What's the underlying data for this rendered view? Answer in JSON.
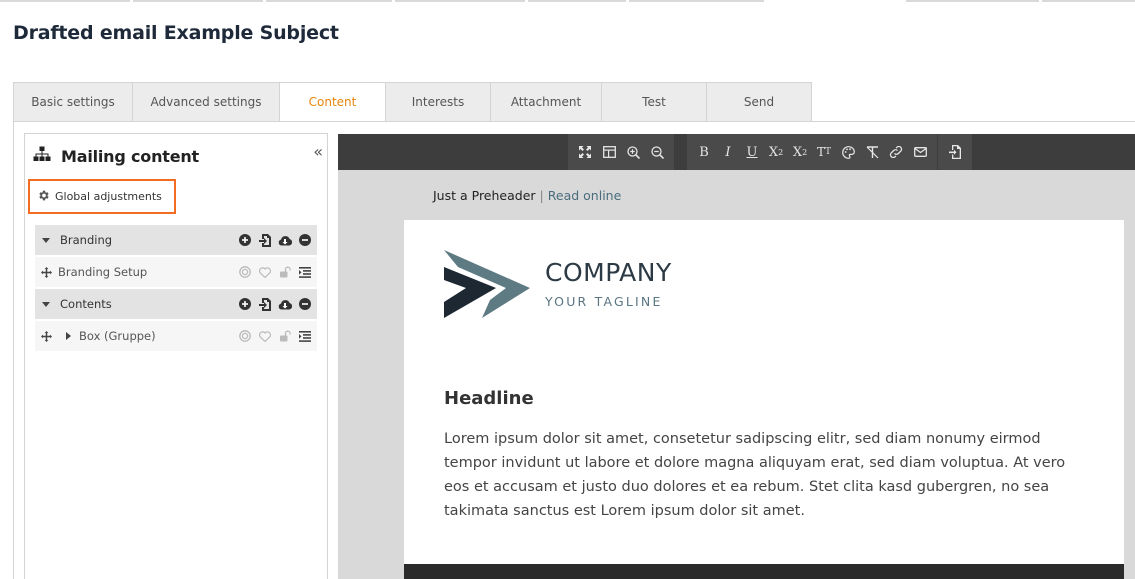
{
  "page": {
    "title": "Drafted email Example Subject"
  },
  "tabs": [
    {
      "label": "Basic settings",
      "active": false
    },
    {
      "label": "Advanced settings",
      "active": false
    },
    {
      "label": "Content",
      "active": true
    },
    {
      "label": "Interests",
      "active": false
    },
    {
      "label": "Attachment",
      "active": false
    },
    {
      "label": "Test",
      "active": false
    },
    {
      "label": "Send",
      "active": false
    }
  ],
  "left_panel": {
    "title": "Mailing content",
    "collapse_icon": "double-chevron-left-icon",
    "global_adjustments": "Global adjustments",
    "tree": [
      {
        "type": "group",
        "label": "Branding"
      },
      {
        "type": "item",
        "label": "Branding Setup"
      },
      {
        "type": "group",
        "label": "Contents"
      },
      {
        "type": "item",
        "label": "Box (Gruppe)"
      }
    ]
  },
  "toolbar": {
    "groups": [
      [
        "maximize-icon",
        "layout-icon",
        "zoom-in-icon",
        "zoom-out-icon"
      ],
      [
        "bold-icon",
        "italic-icon",
        "underline-icon",
        "superscript-icon",
        "subscript-icon",
        "font-size-icon",
        "color-palette-icon",
        "clear-format-icon",
        "link-icon",
        "email-icon"
      ],
      [
        "import-icon"
      ]
    ]
  },
  "email": {
    "preheader": "Just a Preheader",
    "separator": "|",
    "read_online": "Read online",
    "company": "COMPANY",
    "tagline": "YOUR TAGLINE",
    "headline": "Headline",
    "body": "Lorem ipsum dolor sit amet, consetetur sadipscing elitr, sed diam nonumy eirmod tempor invidunt ut labore et dolore magna aliquyam erat, sed diam voluptua. At vero eos et accusam et justo duo dolores et ea rebum. Stet clita kasd gubergren, no sea takimata sanctus est Lorem ipsum dolor sit amet."
  },
  "colors": {
    "accent_tab": "#e8860c",
    "highlight_border": "#f26d21",
    "toolbar_bg": "#3d3d3d",
    "logo_dark": "#1d2833",
    "logo_light": "#5e7a82"
  }
}
